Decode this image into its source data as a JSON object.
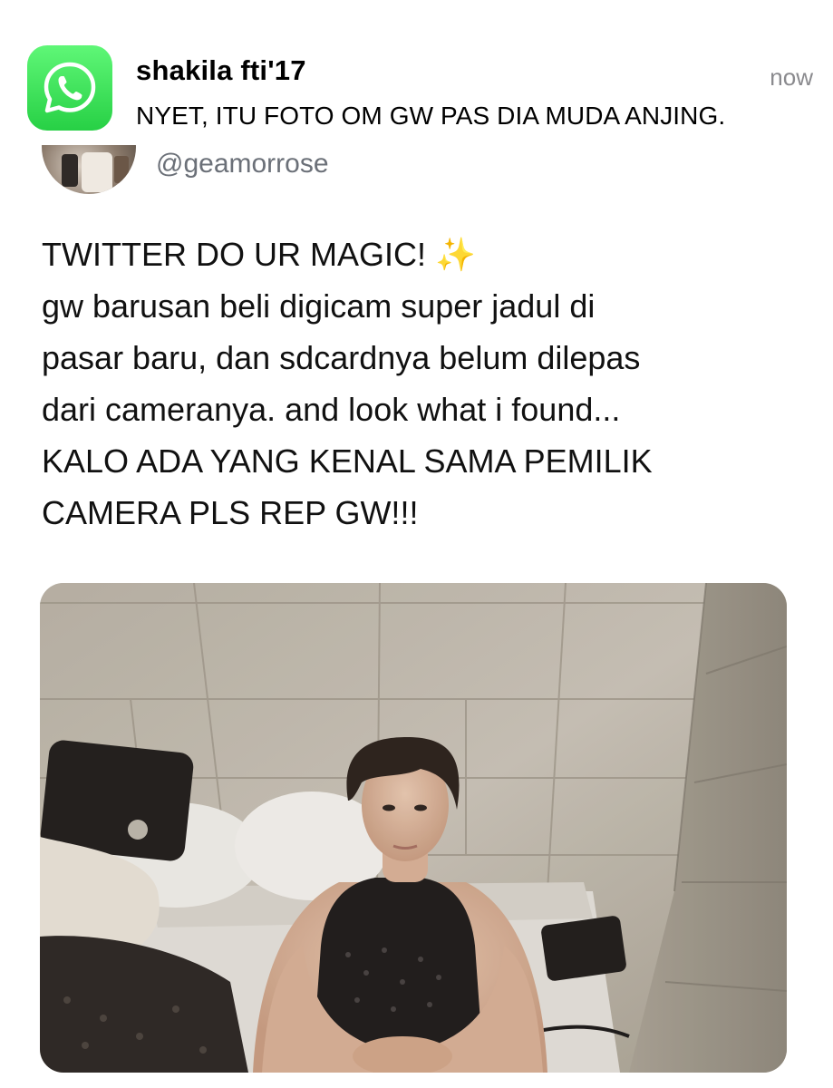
{
  "notification": {
    "app_icon": "whatsapp-icon",
    "sender": "shakila fti'17",
    "time": "now",
    "message": "NYET, ITU FOTO OM GW PAS DIA MUDA ANJING."
  },
  "tweet": {
    "handle": "@geamorrose",
    "lines": [
      "TWITTER DO UR MAGIC! ",
      "gw barusan beli digicam super jadul di",
      "pasar baru, dan sdcardnya belum dilepas",
      "dari cameranya. and look what i found...",
      "KALO ADA YANG KENAL SAMA PEMILIK",
      "CAMERA PLS REP GW!!!"
    ],
    "emoji": "✨"
  },
  "colors": {
    "whatsapp_green": "#27d045",
    "secondary_text": "#6b7078"
  }
}
